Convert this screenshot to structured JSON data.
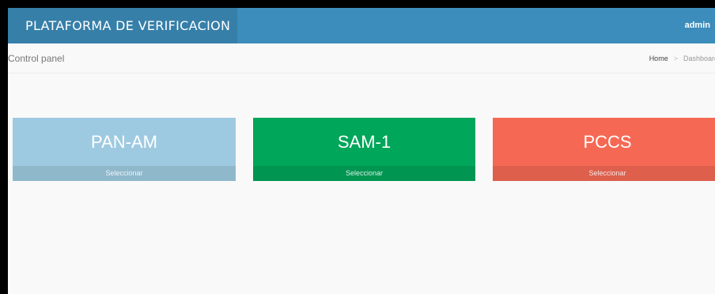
{
  "header": {
    "brand": "PLATAFORMA DE VERIFICACION",
    "user": "admin",
    "colors": {
      "header": "#3c8dbc",
      "brand": "#367fa9"
    }
  },
  "content_header": {
    "title": "Control panel",
    "breadcrumb": {
      "home": "Home",
      "separator": ">",
      "current": "Dashboard"
    }
  },
  "tiles": [
    {
      "title": "PAN-AM",
      "action": "Seleccionar",
      "color": "#9ecae1"
    },
    {
      "title": "SAM-1",
      "action": "Seleccionar",
      "color": "#00a65a"
    },
    {
      "title": "PCCS",
      "action": "Seleccionar",
      "color": "#f56954"
    }
  ]
}
